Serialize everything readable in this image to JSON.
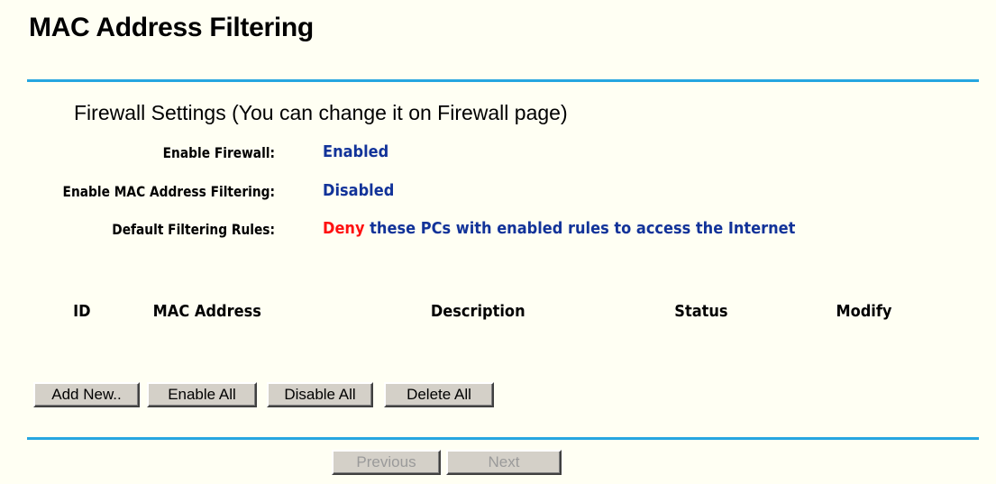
{
  "page": {
    "title": "MAC Address Filtering"
  },
  "firewall_settings": {
    "title": "Firewall Settings (You can change it on Firewall page)",
    "enable_firewall": {
      "label": "Enable Firewall:",
      "value": "Enabled"
    },
    "enable_mac_filtering": {
      "label": "Enable MAC Address Filtering:",
      "value": "Disabled"
    },
    "default_rules": {
      "label": "Default Filtering Rules:",
      "action": "Deny",
      "text": "these PCs with enabled rules to access the Internet"
    }
  },
  "table": {
    "columns": [
      "ID",
      "MAC Address",
      "Description",
      "Status",
      "Modify"
    ]
  },
  "buttons": {
    "add_new": "Add New..",
    "enable_all": "Enable All",
    "disable_all": "Disable All",
    "delete_all": "Delete All",
    "previous": "Previous",
    "next": "Next"
  },
  "colors": {
    "background": "#fffff3",
    "rule": "#26a6e0",
    "value_text": "#123399",
    "deny_text": "#ff1111"
  }
}
